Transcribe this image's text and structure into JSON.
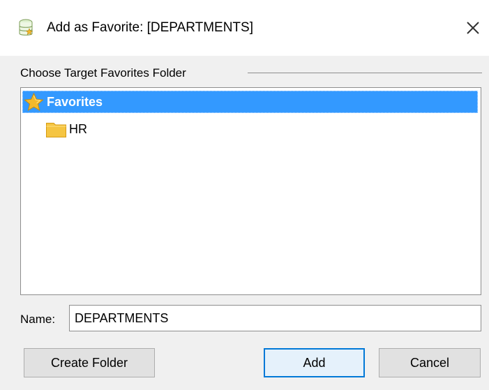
{
  "window": {
    "title": "Add as Favorite: [DEPARTMENTS]",
    "icon": "favorites-database-icon",
    "close_icon": "close-icon"
  },
  "target_folder": {
    "group_label": "Choose Target Favorites Folder",
    "tree": {
      "root": {
        "label": "Favorites",
        "icon": "star-icon",
        "selected": true
      },
      "children": [
        {
          "label": "HR",
          "icon": "folder-icon"
        }
      ]
    }
  },
  "name_field": {
    "label": "Name:",
    "value": "DEPARTMENTS"
  },
  "buttons": {
    "create_folder": "Create Folder",
    "add": "Add",
    "cancel": "Cancel"
  },
  "colors": {
    "selection": "#3399ff",
    "default_button_border": "#0078d7",
    "star": "#f2b92c",
    "folder": "#f5c542"
  }
}
